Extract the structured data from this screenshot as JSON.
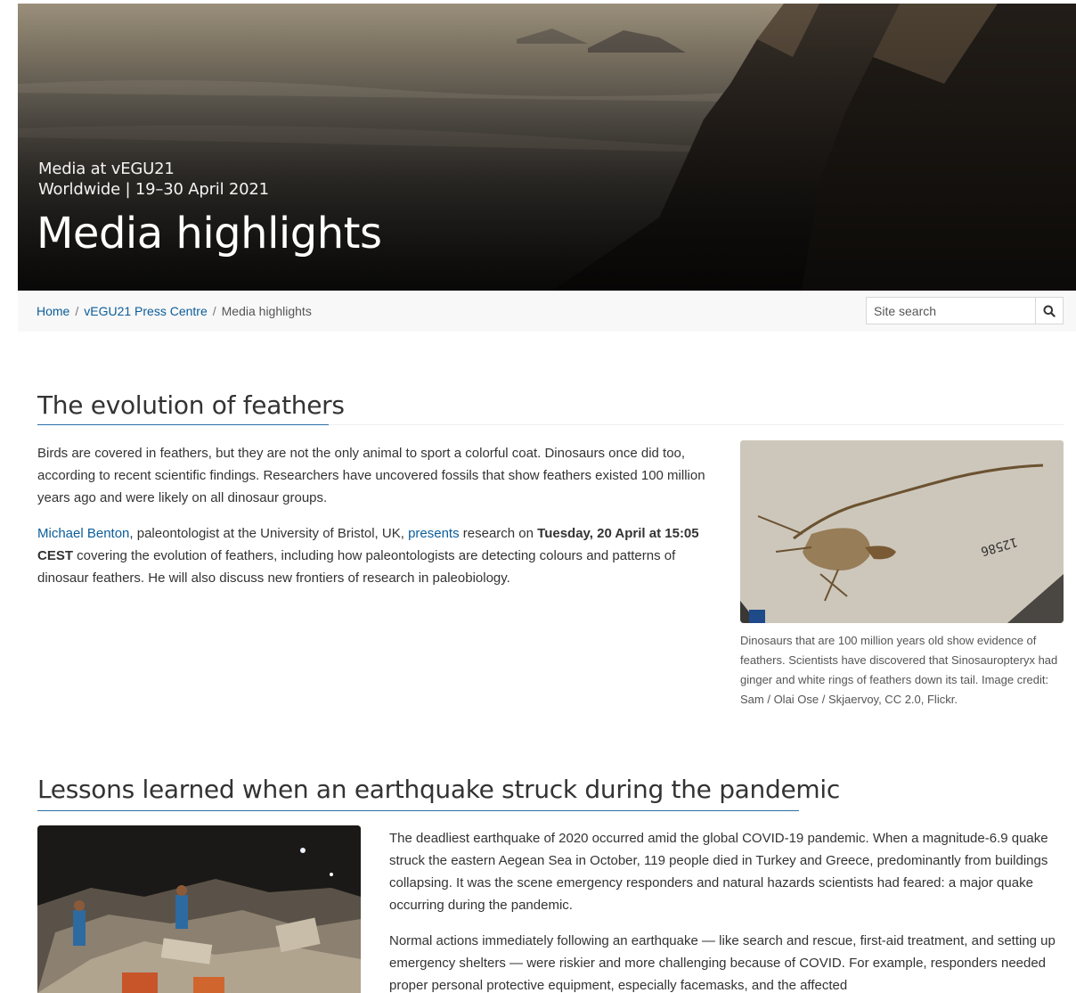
{
  "hero": {
    "subtitle_line1": "Media at vEGU21",
    "subtitle_line2": "Worldwide | 19–30 April 2021",
    "title": "Media highlights"
  },
  "breadcrumb": {
    "home": "Home",
    "separator": "/",
    "press_centre": "vEGU21 Press Centre",
    "current": "Media highlights"
  },
  "search": {
    "placeholder": "Site search",
    "icon": "search-icon"
  },
  "section1": {
    "heading": "The evolution of feathers",
    "paragraph1": "Birds are covered in feathers, but they are not the only animal to sport a colorful coat. Dinosaurs once did too, according to recent scientific findings. Researchers have uncovered fossils that show feathers existed 100 million years ago and were likely on all dinosaur groups.",
    "p2_link1": "Michael Benton",
    "p2_text1": ", paleontologist at the University of Bristol, UK, ",
    "p2_link2": "presents",
    "p2_text2": " research on ",
    "p2_bold": "Tuesday, 20 April at 15:05 CEST",
    "p2_text3": " covering the evolution of feathers, including how paleontologists are detecting colours and patterns of dinosaur feathers. He will also discuss new frontiers of research in paleobiology.",
    "image_label": "12586",
    "caption": "Dinosaurs that are 100 million years old show evidence of feathers. Scientists have discovered that Sinosauropteryx had ginger and white rings of feathers down its tail. Image credit: Sam / Olai Ose / Skjaervoy, CC 2.0, Flickr."
  },
  "section2": {
    "heading": "Lessons learned when an earthquake struck during the pandemic",
    "paragraph1": "The deadliest earthquake of 2020 occurred amid the global COVID-19 pandemic. When a magnitude-6.9 quake struck the eastern Aegean Sea in October, 119 people died in Turkey and Greece, predominantly from buildings collapsing. It was the scene emergency responders and natural hazards scientists had feared: a major quake occurring during the pandemic.",
    "paragraph2": "Normal actions immediately following an earthquake — like search and rescue, first-aid treatment, and setting up emergency shelters — were riskier and more challenging because of COVID. For example, responders needed proper personal protective equipment, especially facemasks, and the affected"
  },
  "colors": {
    "link": "#0b5d9a",
    "heading_underline": "#2a6fa8",
    "breadcrumb_bg": "#f8f8f8"
  }
}
